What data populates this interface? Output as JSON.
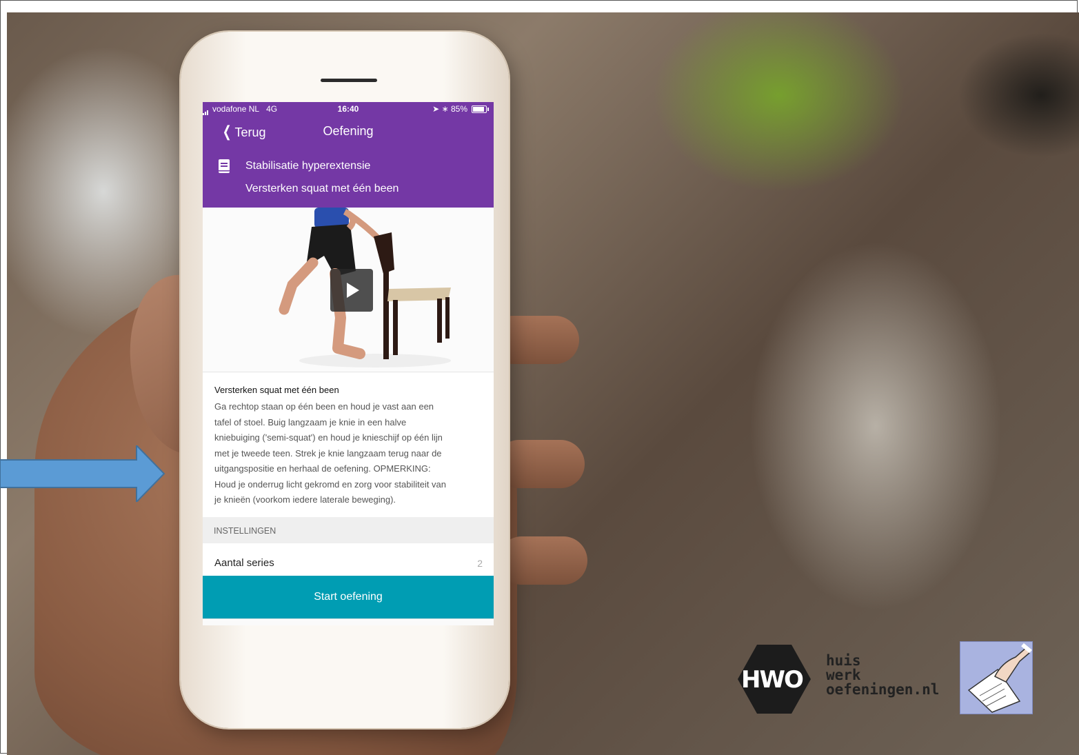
{
  "status_bar": {
    "carrier": "vodafone NL",
    "network": "4G",
    "time": "16:40",
    "battery": "85%"
  },
  "nav": {
    "back_label": "Terug",
    "title": "Oefening"
  },
  "program": {
    "name": "Stabilisatie hyperextensie",
    "exercise": "Versterken squat met één been"
  },
  "description": {
    "title": "Versterken squat met één been",
    "lines": [
      "Ga rechtop staan op één been en houd je vast aan een",
      "tafel of stoel. Buig langzaam je knie in een halve",
      "kniebuiging ('semi-squat') en houd je knieschijf op één lijn",
      "met je tweede teen. Strek je knie langzaam terug naar de",
      "uitgangspositie en herhaal de oefening. OPMERKING:",
      "Houd je onderrug licht gekromd en zorg voor stabiliteit van",
      "je knieën (voorkom iedere laterale beweging)."
    ]
  },
  "settings": {
    "header": "INSTELLINGEN",
    "row_label": "Aantal series",
    "row_value": "2"
  },
  "start_button": "Start oefening",
  "branding": {
    "hwo": "HWO",
    "site_lines": [
      "huis",
      "werk",
      "oefeningen.nl"
    ]
  },
  "colors": {
    "header": "#7438a5",
    "button": "#009db3",
    "arrow": "#5b9bd5"
  }
}
